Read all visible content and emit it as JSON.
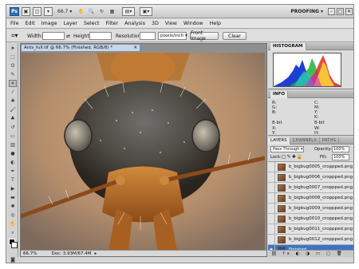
{
  "app": {
    "zoom": "66.7",
    "workspace": "PROOFING",
    "ps": "Ps"
  },
  "menu": [
    "File",
    "Edit",
    "Image",
    "Layer",
    "Select",
    "Filter",
    "Analysis",
    "3D",
    "View",
    "Window",
    "Help"
  ],
  "options": {
    "width_label": "Width:",
    "height_label": "Height:",
    "resolution_label": "Resolution:",
    "resolution_unit": "pixels/inch",
    "front_image": "Front Image",
    "clear": "Clear"
  },
  "document": {
    "tab_title": "Ants_full.tif @ 66.7% (Finished, RGB/8) *",
    "zoom": "66.7%",
    "doc_size": "Doc: 3.93M/67.4M"
  },
  "histogram": {
    "title": "HISTOGRAM"
  },
  "info": {
    "title": "INFO",
    "r": "R:",
    "g": "G:",
    "b": "B:",
    "c": "C:",
    "m": "M:",
    "y": "Y:",
    "k": "K:",
    "bit1": "8-bit",
    "bit2": "8-bit",
    "x": "X:",
    "yy": "Y:",
    "w": "W:",
    "h": "H:"
  },
  "layers": {
    "tabs": [
      "LAYERS",
      "CHANNELS",
      "PATHS"
    ],
    "blend": "Pass Through",
    "opacity_label": "Opacity:",
    "opacity": "100%",
    "lock_label": "Lock:",
    "fill_label": "Fill:",
    "fill": "100%",
    "items": [
      "b_bigbug0005_croppped.png",
      "b_bigbug0006_croppped.png",
      "b_bigbug0007_croppped.png",
      "b_bigbug0008_croppped.png",
      "b_bigbug0009_croppped.png",
      "b_bigbug0010_croppped.png",
      "b_bigbug0011_croppped.png",
      "b_bigbug0012_croppped.png"
    ],
    "selected": "Finished"
  }
}
